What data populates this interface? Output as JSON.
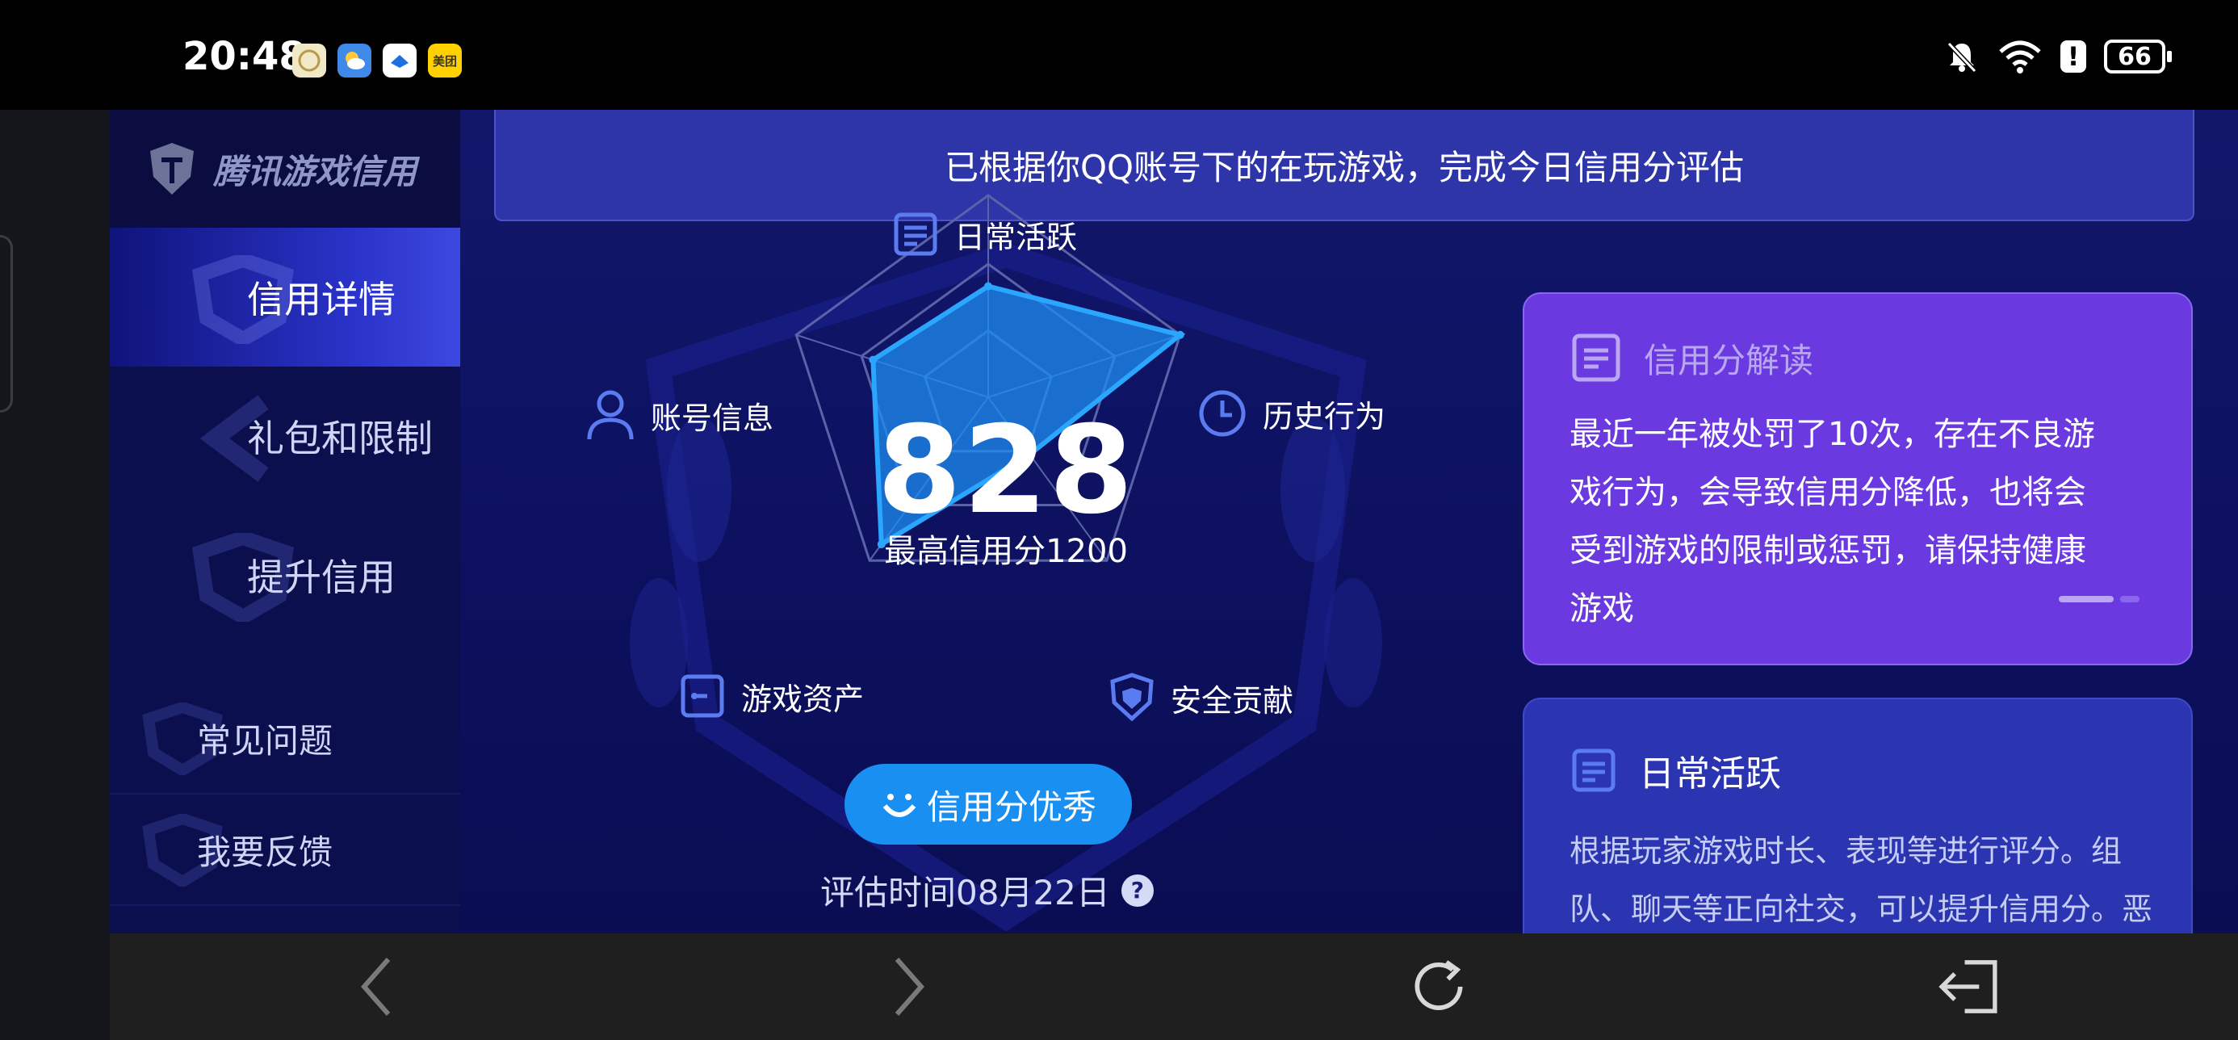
{
  "status_bar": {
    "time": "20:48",
    "apps": [
      {
        "icon": "app-icon-1",
        "color": "#f1e8c8"
      },
      {
        "icon": "weather-icon",
        "color": "#3f8ae8"
      },
      {
        "icon": "app-icon-3",
        "color": "#ffffff"
      },
      {
        "icon": "meituan-icon",
        "color": "#ffd100",
        "label": "美团"
      }
    ],
    "battery": "66",
    "icons": [
      "mute-icon",
      "wifi-icon",
      "alert-icon",
      "battery-icon"
    ]
  },
  "sidebar": {
    "brand": "腾讯游戏信用",
    "items": [
      {
        "label": "信用详情",
        "active": true
      },
      {
        "label": "礼包和限制",
        "active": false
      },
      {
        "label": "提升信用",
        "active": false
      }
    ],
    "sub_items": [
      {
        "label": "常见问题"
      },
      {
        "label": "我要反馈"
      }
    ]
  },
  "banner": "已根据你QQ账号下的在玩游戏，完成今日信用分评估",
  "radar": {
    "score": "828",
    "max_label": "最高信用分1200",
    "axes": [
      {
        "label": "日常活跃",
        "icon": "document-icon",
        "value": 0.55
      },
      {
        "label": "历史行为",
        "icon": "clock-icon",
        "value": 1.0
      },
      {
        "label": "安全贡献",
        "icon": "shield-icon",
        "value": 0.35
      },
      {
        "label": "游戏资产",
        "icon": "asset-icon",
        "value": 0.9
      },
      {
        "label": "账号信息",
        "icon": "user-icon",
        "value": 0.6
      }
    ],
    "colors": {
      "fill": "#1e8df2",
      "stroke": "#2aa6ff",
      "grid": "#5a62a8"
    }
  },
  "badge": "信用分优秀",
  "eval_time": "评估时间08月22日",
  "card_interpret": {
    "title": "信用分解读",
    "lines": [
      "最近一年被处罚了10次，存在不良游",
      "戏行为，会导致信用分降低，也将会",
      "受到游戏的限制或惩罚，请保持健康",
      "游戏"
    ]
  },
  "card_daily": {
    "title": "日常活跃",
    "lines": [
      "根据玩家游戏时长、表现等进行评分。组",
      "队、聊天等正向社交，可以提升信用分。恶"
    ]
  }
}
